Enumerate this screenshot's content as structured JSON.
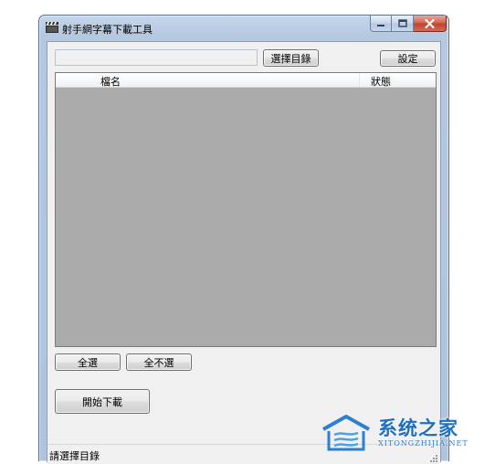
{
  "window": {
    "title": "射手網字幕下載工具",
    "icon": "clapperboard-icon",
    "controls": [
      "minimize-icon",
      "maximize-icon",
      "close-icon"
    ]
  },
  "toolbar": {
    "path_value": "",
    "browse_label": "選擇目錄",
    "settings_label": "設定"
  },
  "file_list": {
    "columns": [
      "檔名",
      "狀態"
    ],
    "rows": []
  },
  "actions": {
    "select_all_label": "全選",
    "select_none_label": "全不選",
    "start_download_label": "開始下載"
  },
  "statusbar": {
    "text": "請選擇目錄"
  },
  "watermark": {
    "text": "系统之家",
    "subtext": "XITONGZHIJIA.NET"
  },
  "colors": {
    "list_background": "#ababab",
    "window_frame": "#b4c8e0",
    "close_button": "#c7432f",
    "watermark_blue": "#1f6fc0"
  }
}
